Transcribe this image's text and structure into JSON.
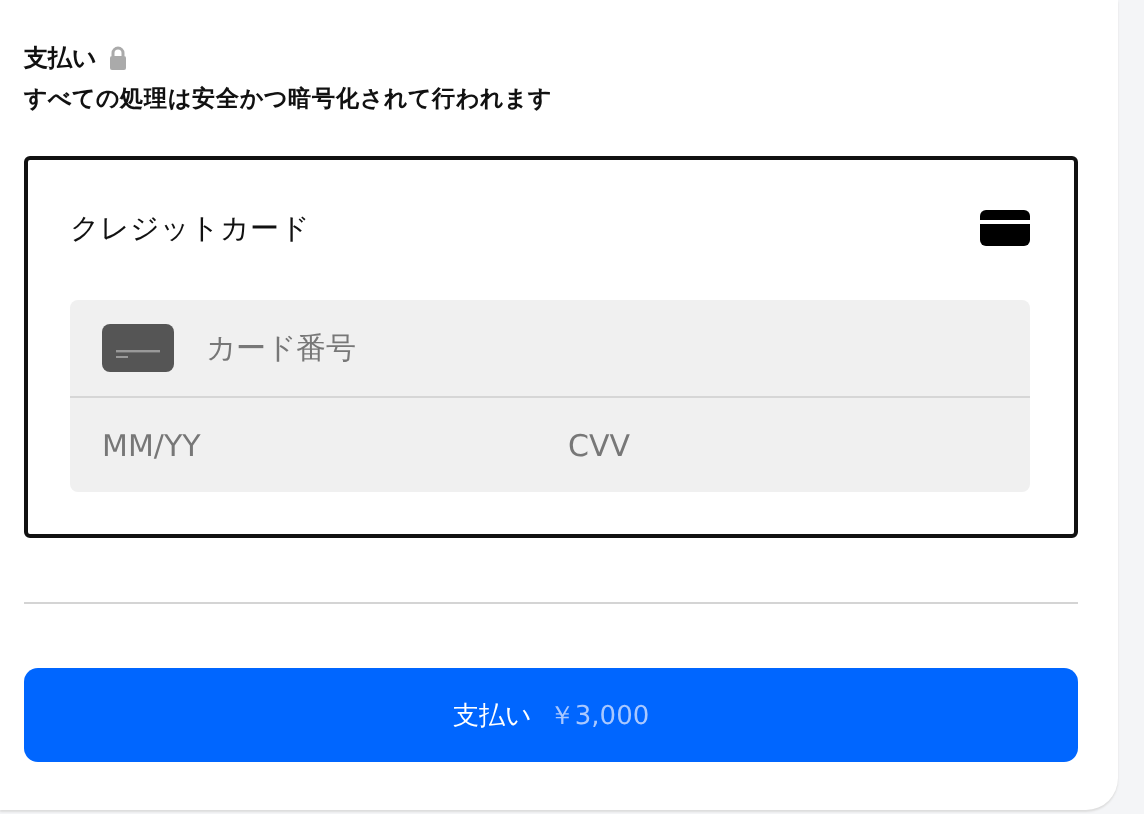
{
  "header": {
    "title": "支払い",
    "subtitle": "すべての処理は安全かつ暗号化されて行われます"
  },
  "card_form": {
    "title": "クレジットカード",
    "card_number": {
      "placeholder": "カード番号"
    },
    "expiry": {
      "placeholder": "MM/YY"
    },
    "cvv": {
      "placeholder": "CVV"
    }
  },
  "pay_button": {
    "label": "支払い",
    "amount": "￥3,000"
  }
}
